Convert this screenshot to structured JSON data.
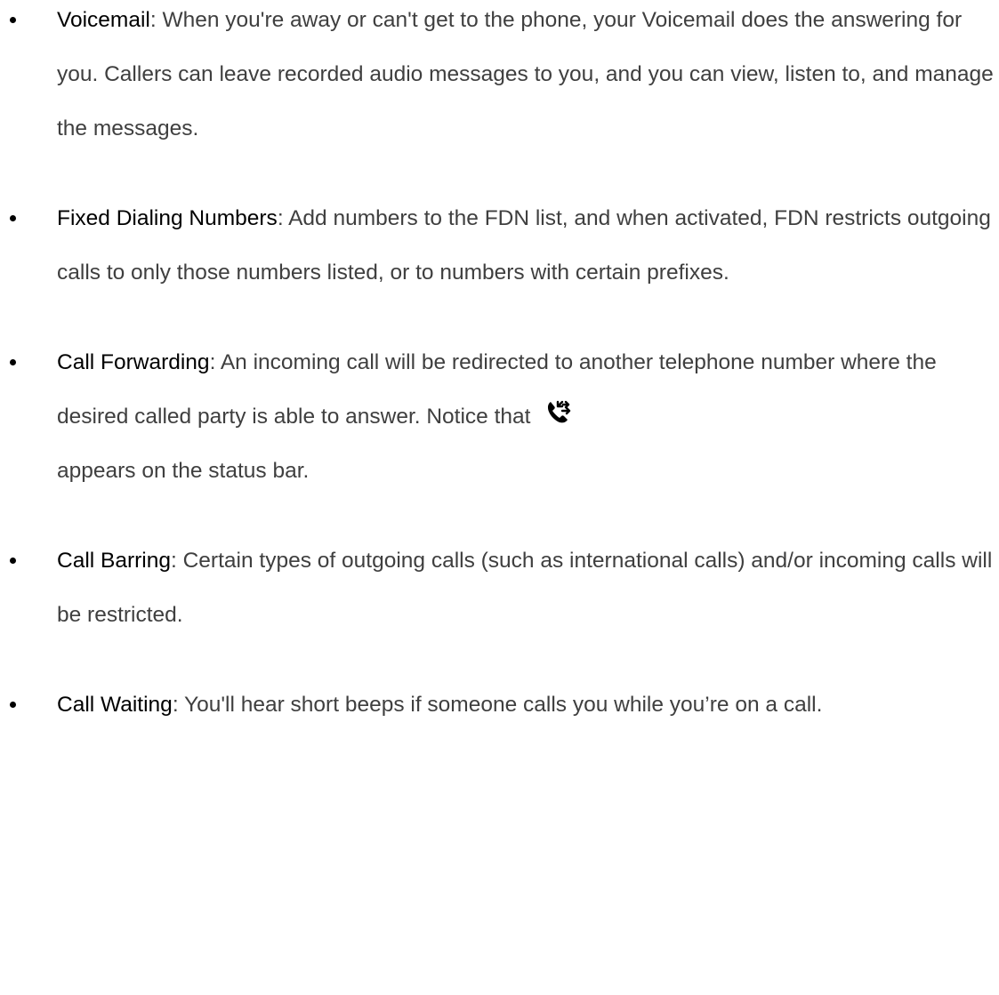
{
  "items": [
    {
      "term": "Voicemail",
      "text": ": When you're away or can't get to the phone, your Voicemail does the answering for you. Callers can leave recorded audio messages to you, and you can view, listen to, and manage the messages."
    },
    {
      "term": "Fixed Dialing Numbers",
      "text": ": Add numbers to the FDN list, and when activated, FDN restricts outgoing calls to only those numbers listed, or to numbers with certain prefixes."
    },
    {
      "term": "Call Forwarding",
      "text_before_icon": ": An incoming call will be redirected to another telephone number where the desired called party is able to answer. Notice that ",
      "icon": "call-forwarding-icon",
      "text_after_icon": "appears on the status bar."
    },
    {
      "term": "Call Barring",
      "text": ": Certain types of outgoing calls (such as international calls) and/or incoming calls will be restricted."
    },
    {
      "term": "Call Waiting",
      "text": ": You'll hear short beeps if someone calls you while you’re on a call."
    }
  ]
}
